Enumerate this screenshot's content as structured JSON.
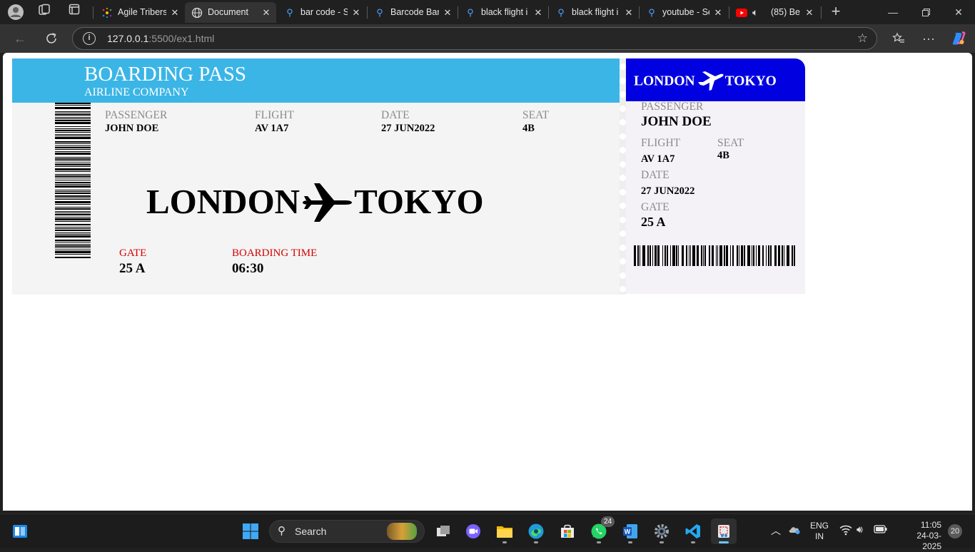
{
  "browser": {
    "tabs": [
      {
        "label": "Agile Tribers",
        "icon": "agile-tribers-favicon",
        "active": false
      },
      {
        "label": "Document",
        "icon": "globe-icon",
        "active": true
      },
      {
        "label": "bar code - S",
        "icon": "search-icon",
        "active": false
      },
      {
        "label": "Barcode Bar",
        "icon": "search-icon",
        "active": false
      },
      {
        "label": "black flight i",
        "icon": "search-icon",
        "active": false
      },
      {
        "label": "black flight i",
        "icon": "search-icon",
        "active": false
      },
      {
        "label": "youtube - Se",
        "icon": "search-icon",
        "active": false
      },
      {
        "label": "(85) Be",
        "icon": "youtube-icon",
        "active": false
      }
    ],
    "url_host": "127.0.0.1",
    "url_rest": ":5500/ex1.html"
  },
  "boarding_pass": {
    "title": "BOARDING PASS",
    "subtitle": "AIRLINE COMPANY",
    "passenger_label": "PASSENGER",
    "passenger": "JOHN DOE",
    "flight_label": "FLIGHT",
    "flight": "AV 1A7",
    "date_label": "DATE",
    "date": "27 JUN2022",
    "seat_label": "SEAT",
    "seat": "4B",
    "origin": "LONDON",
    "destination": "TOKYO",
    "gate_label": "GATE",
    "gate": "25 A",
    "boarding_time_label": "BOARDING TIME",
    "boarding_time": "06:30",
    "colors": {
      "header": "#3bb5e6",
      "stub_header": "#0000e0",
      "accent_red": "#d40000"
    }
  },
  "stub": {
    "origin": "LONDON",
    "destination": "TOKYO",
    "passenger_label": "PASSENGER",
    "passenger": "JOHN DOE",
    "flight_label": "FLIGHT",
    "flight": "AV 1A7",
    "seat_label": "SEAT",
    "seat": "4B",
    "date_label": "DATE",
    "date": "27 JUN2022",
    "gate_label": "GATE",
    "gate": "25 A"
  },
  "taskbar": {
    "search_label": "Search",
    "whatsapp_badge": "24",
    "language": "ENG",
    "region": "IN",
    "time": "11:05",
    "date": "24-03-2025",
    "notification_count": "20"
  }
}
